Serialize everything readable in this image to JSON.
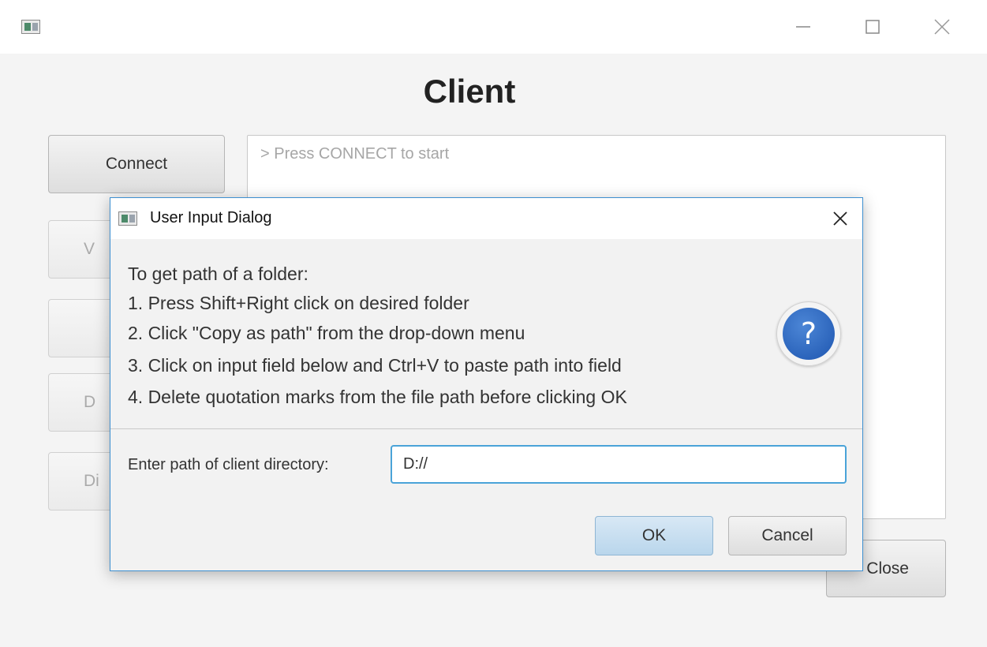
{
  "window": {
    "title": "",
    "minimize_label": "—",
    "maximize_label": "☐",
    "close_label": "✕"
  },
  "main": {
    "heading": "Client",
    "buttons": {
      "connect": "Connect",
      "partial_1": "V",
      "partial_2": "",
      "partial_3": "D",
      "partial_4": "Di",
      "close": "Close"
    },
    "console_text": "> Press CONNECT to start"
  },
  "dialog": {
    "title": "User Input Dialog",
    "instructions": [
      "To get path of a folder:",
      "1. Press Shift+Right click on desired folder",
      "2. Click \"Copy as path\" from the drop-down menu",
      "3. Click on input field below and Ctrl+V to paste path into field",
      "4. Delete quotation marks from the file path before clicking OK"
    ],
    "icon": "question-icon",
    "icon_glyph": "?",
    "path_label": "Enter path of client directory:",
    "path_value": "D://",
    "ok_label": "OK",
    "cancel_label": "Cancel"
  }
}
